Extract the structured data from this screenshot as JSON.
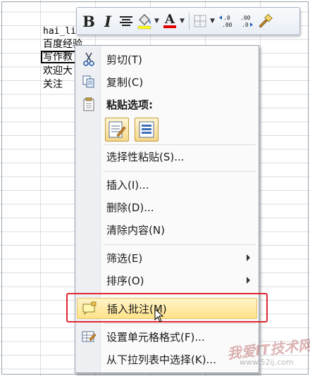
{
  "cells": [
    "hai_lin",
    "百度经验",
    "写作教",
    "欢迎大",
    "关注"
  ],
  "mini_toolbar": {
    "bold": "B",
    "italic": "I",
    "align": "≡",
    "font_color_letter": "A",
    "increase_decimal": "←.0\n.00",
    "decrease_decimal": ".00\n→.0"
  },
  "menu": {
    "cut": "剪切(T)",
    "copy": "复制(C)",
    "paste_options": "粘贴选项:",
    "paste_special": "选择性粘贴(S)...",
    "insert": "插入(I)...",
    "delete": "删除(D)...",
    "clear_contents": "清除内容(N)",
    "filter": "筛选(E)",
    "sort": "排序(O)",
    "insert_comment": "插入批注(M)",
    "format_cells": "设置单元格格式(F)...",
    "pick_from_list": "从下拉列表中选择(K)..."
  },
  "colors": {
    "highlight_fill": "#ffe28a",
    "annotation_red": "#e0262e",
    "font_color_red": "#e00000",
    "highlighter_yellow": "#ffff00"
  },
  "watermark": "我爱IT技术网",
  "watermark_url": "www.52ij.com"
}
